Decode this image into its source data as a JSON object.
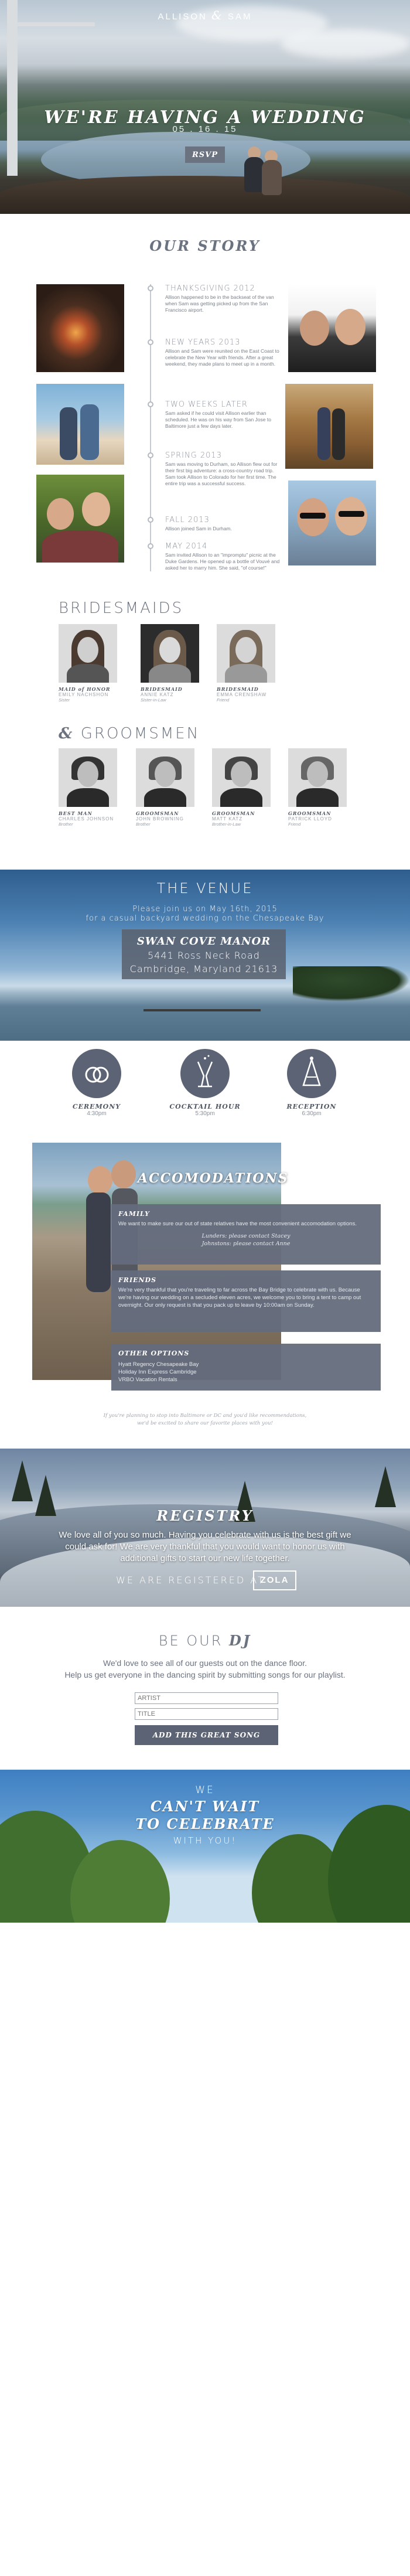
{
  "hero": {
    "brand_left": "ALLISON",
    "brand_amp": "&",
    "brand_right": "SAM",
    "title": "WE'RE HAVING A WEDDING",
    "date": "05 . 16 . 15",
    "rsvp_label": "RSVP"
  },
  "story": {
    "title": "OUR STORY",
    "events": [
      {
        "heading": "THANKSGIVING 2012",
        "text": "Allison happened to be in the backseat of the van when Sam was getting picked up from the San Francisco airport."
      },
      {
        "heading": "NEW YEARS 2013",
        "text": "Allison and Sam were reunited on the East Coast to celebrate the New Year with friends. After a great weekend, they made plans to meet up in a month."
      },
      {
        "heading": "TWO WEEKS LATER",
        "text": "Sam asked if he could visit Allison earlier than scheduled. He was on his way from San Jose to Baltimore just a few days later."
      },
      {
        "heading": "SPRING 2013",
        "text": "Sam was moving to Durham, so Allison flew out for their first big adventure: a cross-country road trip. Sam took Allison to Colorado for her first time. The entire trip was a successful success."
      },
      {
        "heading": "FALL 2013",
        "text": "Allison joined Sam in Durham."
      },
      {
        "heading": "MAY 2014",
        "text": "Sam invited Allison to an \"impromptu\" picnic at the Duke Gardens. He opened up a bottle of Vouvé and asked her to marry him. She said, \"of course!\""
      }
    ]
  },
  "bridesmaids": {
    "title": "BRIDESMAIDS",
    "members": [
      {
        "role": "MAID of HONOR",
        "name": "EMILY NACHSHON",
        "relation": "Sister"
      },
      {
        "role": "BRIDESMAID",
        "name": "ANNIE KATZ",
        "relation": "Sister-in-Law"
      },
      {
        "role": "BRIDESMAID",
        "name": "EMMA CRENSHAW",
        "relation": "Friend"
      }
    ]
  },
  "groomsmen": {
    "title_amp": "&",
    "title": "GROOMSMEN",
    "members": [
      {
        "role": "BEST MAN",
        "name": "CHARLES JOHNSON",
        "relation": "Brother"
      },
      {
        "role": "GROOMSMAN",
        "name": "JOHN BROWNING",
        "relation": "Brother"
      },
      {
        "role": "GROOMSMAN",
        "name": "MATT KATZ",
        "relation": "Brother-in-Law"
      },
      {
        "role": "GROOMSMAN",
        "name": "PATRICK LLOYD",
        "relation": "Friend"
      }
    ]
  },
  "venue": {
    "title": "THE VENUE",
    "line1": "Please join us on May 16th, 2015",
    "line2": "for a casual backyard wedding on the Chesapeake Bay",
    "name": "SWAN COVE MANOR",
    "street": "5441 Ross Neck Road",
    "city": "Cambridge, Maryland 21613"
  },
  "events": [
    {
      "label": "CEREMONY",
      "time": "4:30pm",
      "icon": "rings-icon"
    },
    {
      "label": "COCKTAIL HOUR",
      "time": "5:30pm",
      "icon": "champagne-icon"
    },
    {
      "label": "RECEPTION",
      "time": "6:30pm",
      "icon": "party-hat-icon"
    }
  ],
  "accomodations": {
    "title": "ACCOMODATIONS",
    "family_heading": "FAMILY",
    "family_text": "We want to make sure our out of state relatives have the most convenient accomodation options.",
    "family_link1": "Lunders: please contact Stacey",
    "family_link2": "Johnstons: please contact Anne",
    "friends_heading": "FRIENDS",
    "friends_text": "We're very thankful that you're traveling to far across the Bay Bridge to celebrate with us. Because we're having our wedding on a secluded eleven acres, we welcome you to bring a tent to camp out overnight. Our only request is that you pack up to leave by 10:00am on Sunday.",
    "other_heading": "OTHER OPTIONS",
    "other_items": [
      "Hyatt Regency Chesapeake Bay",
      "Holiday Inn Express Cambridge",
      "VRBO Vacation Rentals"
    ],
    "note1": "If you're planning to stop into Baltimore or DC and you'd like recommendations,",
    "note2": "we'd be excited to share our favorite places with you!"
  },
  "registry": {
    "title": "REGISTRY",
    "text": "We love all of you so much. Having you celebrate with us is the best gift we could ask for! We are very thankful that you would want to honor us with additional gifts to start our new life together.",
    "registered_at": "WE ARE REGISTERED AT",
    "zola": "ZOLA"
  },
  "dj": {
    "title_prefix": "BE OUR",
    "title_em": "DJ",
    "line1": "We'd love to see all of our guests out on the dance floor.",
    "line2": "Help us get everyone in the dancing spirit by submitting songs for our playlist.",
    "artist_placeholder": "ARTIST",
    "title_placeholder": "TITLE",
    "add_label": "ADD THIS GREAT SONG"
  },
  "footer": {
    "we": "WE",
    "cant_wait": "CAN'T WAIT",
    "to_celebrate": "TO CELEBRATE",
    "with_you": "WITH YOU!"
  }
}
